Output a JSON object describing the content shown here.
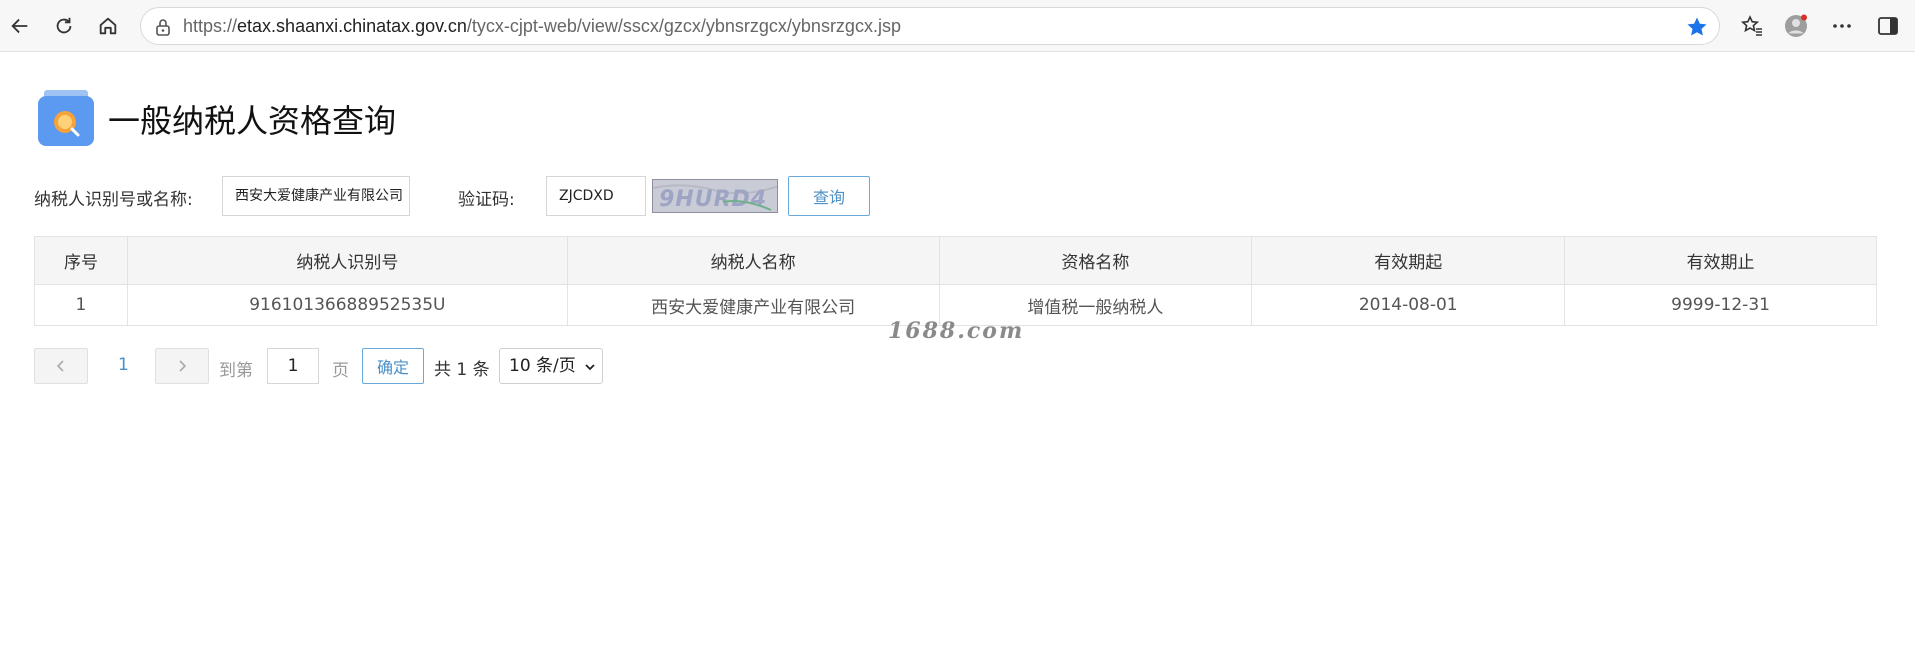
{
  "browser": {
    "url_prefix": "https://",
    "url_host": "etax.shaanxi.chinatax.gov.cn",
    "url_path": "/tycx-cjpt-web/view/sscx/gzcx/ybnsrzgcx/ybnsrzgcx.jsp",
    "star_color": "#1a73e8",
    "profile_dot_color": "#d93025"
  },
  "page": {
    "title": "一般纳税人资格查询"
  },
  "search": {
    "taxpayer_label": "纳税人识别号或名称:",
    "taxpayer_value": "西安大爱健康产业有限公司",
    "captcha_label": "验证码:",
    "captcha_value": "ZJCDXD",
    "captcha_image_text": "9HURD4",
    "query_label": "查询"
  },
  "table": {
    "headers": [
      "序号",
      "纳税人识别号",
      "纳税人名称",
      "资格名称",
      "有效期起",
      "有效期止"
    ],
    "rows": [
      [
        "1",
        "91610136688952535U",
        "西安大爱健康产业有限公司",
        "增值税一般纳税人",
        "2014-08-01",
        "9999-12-31"
      ]
    ]
  },
  "watermark": "1688.com",
  "pager": {
    "current_page": "1",
    "goto_label": "到第",
    "goto_value": "1",
    "page_suffix": "页",
    "confirm_label": "确定",
    "total_text": "共 1 条",
    "page_size": "10 条/页",
    "accent_color": "#4a90c8"
  }
}
